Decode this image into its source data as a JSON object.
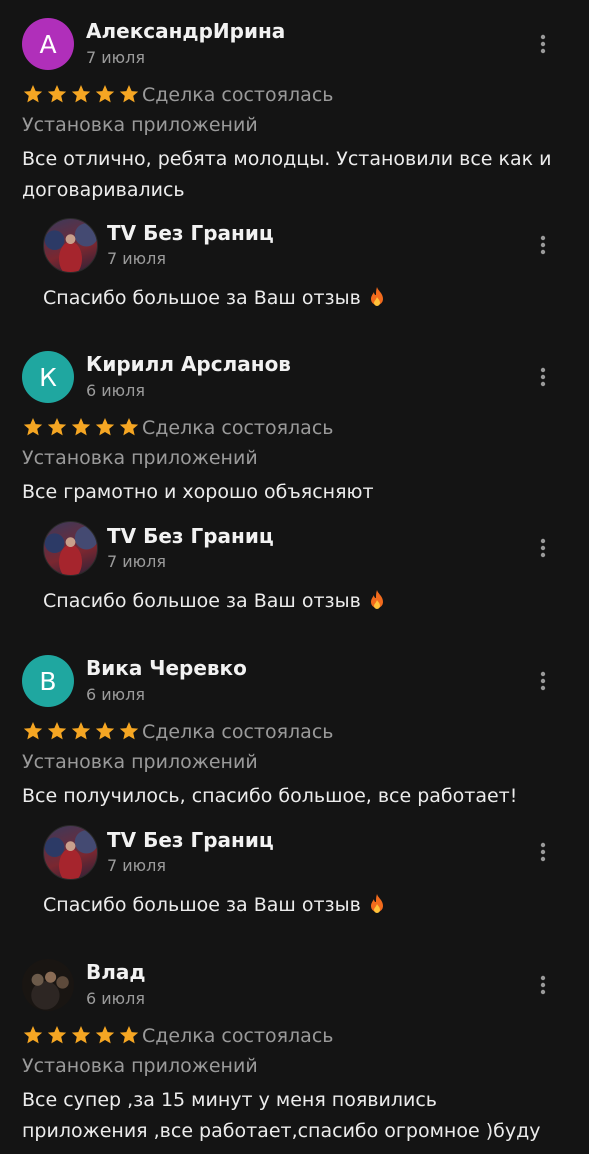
{
  "colors": {
    "background": "#141414",
    "star": "#f5a623",
    "secondary_text": "#9a9a9a",
    "avatar_a": "#b02fba",
    "avatar_k": "#1fa7a0",
    "avatar_b": "#1fa7a0"
  },
  "reviews": [
    {
      "avatar_letter": "А",
      "author": "АлександрИрина",
      "date": "7 июля",
      "rating": 5,
      "status": "Сделка состоялась",
      "category": "Установка приложений",
      "text": "Все отлично, ребята молодцы. Установили все как и договаривались",
      "reply": {
        "author": "TV Без Границ",
        "date": "7 июля",
        "text": "Спасибо большое за Ваш отзыв"
      }
    },
    {
      "avatar_letter": "К",
      "author": "Кирилл Арсланов",
      "date": "6 июля",
      "rating": 5,
      "status": "Сделка состоялась",
      "category": "Установка приложений",
      "text": "Все грамотно и хорошо объясняют",
      "reply": {
        "author": "TV Без Границ",
        "date": "7 июля",
        "text": "Спасибо большое за Ваш отзыв"
      }
    },
    {
      "avatar_letter": "В",
      "author": "Вика Черевко",
      "date": "6 июля",
      "rating": 5,
      "status": "Сделка состоялась",
      "category": "Установка приложений",
      "text": "Все получилось, спасибо большое, все работает!",
      "reply": {
        "author": "TV Без Границ",
        "date": "7 июля",
        "text": "Спасибо большое за Ваш отзыв"
      }
    },
    {
      "avatar_letter": "",
      "author": "Влад",
      "date": "6 июля",
      "rating": 5,
      "status": "Сделка состоялась",
      "category": "Установка приложений",
      "text": "Все супер ,за 15 минут у меня появились приложения ,все работает,спасибо огромное )буду"
    }
  ]
}
